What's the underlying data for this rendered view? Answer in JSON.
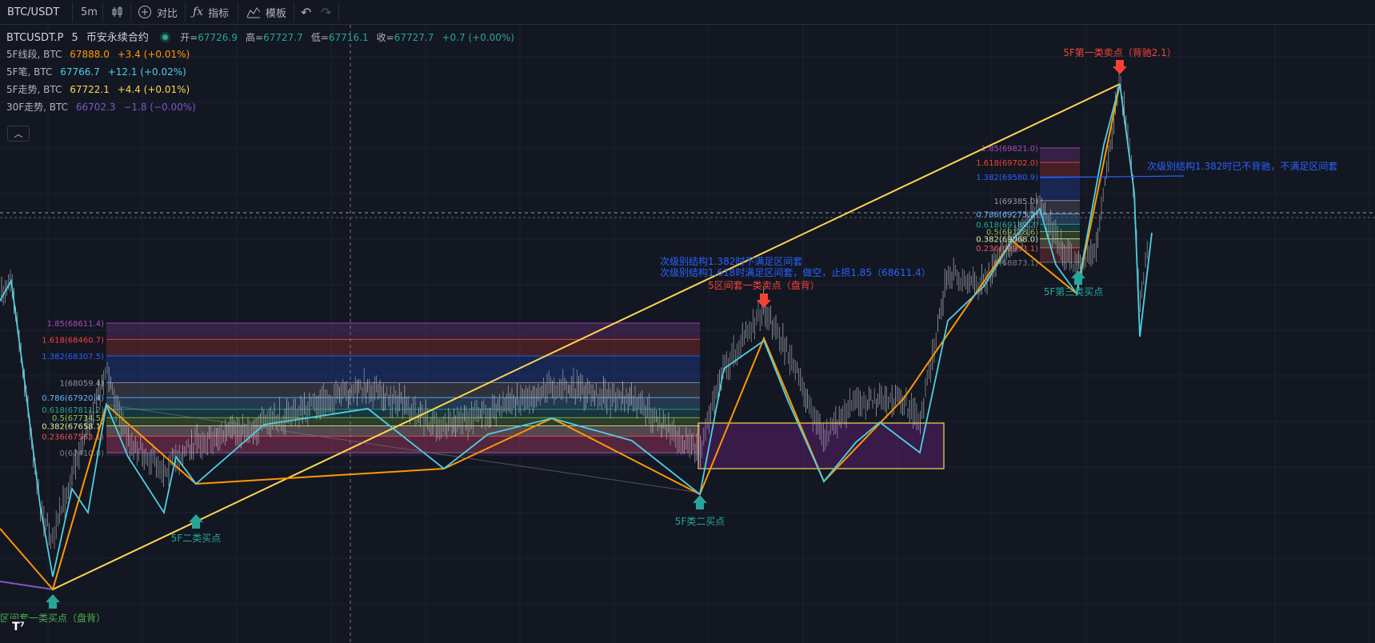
{
  "toolbar": {
    "symbol": "BTC/USDT",
    "interval": "5m",
    "compare_label": "对比",
    "indicators_label": "指标",
    "templates_label": "模板"
  },
  "legend": {
    "symbol": "BTCUSDT.P",
    "interval": "5",
    "exchange": "币安永续合约",
    "open_label": "开=",
    "open": "67726.9",
    "high_label": "高=",
    "high": "67727.7",
    "low_label": "低=",
    "low": "67716.1",
    "close_label": "收=",
    "close": "67727.7",
    "change": "+0.7 (+0.00%)",
    "indicators": [
      {
        "name": "5F线段, BTC",
        "value": "67888.0",
        "change": "+3.4 (+0.01%)",
        "color": "#ff9800"
      },
      {
        "name": "5F笔, BTC",
        "value": "67766.7",
        "change": "+12.1 (+0.02%)",
        "color": "#4dd0e1"
      },
      {
        "name": "5F走势, BTC",
        "value": "67722.1",
        "change": "+4.4 (+0.01%)",
        "color": "#ffd54f"
      },
      {
        "name": "30F走势, BTC",
        "value": "66702.3",
        "change": "−1.8 (−0.00%)",
        "color": "#7e57c2"
      }
    ]
  },
  "chart_data": {
    "type": "candlestick",
    "symbol": "BTCUSDT.P",
    "interval": "5",
    "zones": [
      {
        "name": "zone-1",
        "price_high": 67890,
        "price_low": 67560,
        "color": "#9c27b0"
      },
      {
        "name": "zone-2",
        "price_high": 68180,
        "price_low": 67840,
        "color": "#9c27b0"
      }
    ],
    "fib_left": {
      "levels": [
        {
          "label": "1.85(68611.4)",
          "price": 68611.4,
          "color": "#ab47bc"
        },
        {
          "label": "1.618(68460.7)",
          "price": 68460.7,
          "color": "#f44336"
        },
        {
          "label": "1.382(68307.5)",
          "price": 68307.5,
          "color": "#2962ff"
        },
        {
          "label": "1(68059.4)",
          "price": 68059.4,
          "color": "#9598a1"
        },
        {
          "label": "0.786(67920.4)",
          "price": 67920.4,
          "color": "#64b5f6"
        },
        {
          "label": "0.618(67811.2)",
          "price": 67811.2,
          "color": "#26a69a"
        },
        {
          "label": "0.5(67734.5)",
          "price": 67734.5,
          "color": "#8bc34a"
        },
        {
          "label": "0.382(67658.1)",
          "price": 67658.1,
          "color": "#e6ee9c"
        },
        {
          "label": "0.236(67563.1)",
          "price": 67563.1,
          "color": "#ef5350"
        },
        {
          "label": "0(67410.0)",
          "price": 67410.0,
          "color": "#787b86"
        }
      ]
    },
    "fib_right": {
      "levels": [
        {
          "label": "1.85(69821.0)",
          "price": 69821.0,
          "color": "#ab47bc"
        },
        {
          "label": "1.618(69702.0)",
          "price": 69702.0,
          "color": "#f44336"
        },
        {
          "label": "1.382(69580.9)",
          "price": 69580.9,
          "color": "#2962ff"
        },
        {
          "label": "1(69385.0)",
          "price": 69385.0,
          "color": "#9598a1"
        },
        {
          "label": "0.786(69275.2)",
          "price": 69275.2,
          "color": "#64b5f6"
        },
        {
          "label": "0.618(69189.2)",
          "price": 69189.2,
          "color": "#26a69a"
        },
        {
          "label": "0.5(69128.6)",
          "price": 69128.6,
          "color": "#8bc34a"
        },
        {
          "label": "0.382(69068.0)",
          "price": 69068.0,
          "color": "#e6ee9c"
        },
        {
          "label": "0.236(68993.1)",
          "price": 68993.1,
          "color": "#ef5350"
        },
        {
          "label": "0(68873.1)",
          "price": 68873.1,
          "color": "#787b86"
        }
      ]
    },
    "annotations": [
      {
        "text": "5F第一类卖点（背驰2.1）",
        "color": "#f44336",
        "kind": "sell"
      },
      {
        "text": "次级别结构1.382时已不背驰，不满足区间套",
        "color": "#2962ff",
        "kind": "note"
      },
      {
        "text": "次级别结构1.382时不满足区间套",
        "color": "#2962ff",
        "kind": "note"
      },
      {
        "text": "次级别结构1.618时满足区间套，做空，止损1.85（68611.4）",
        "color": "#2962ff",
        "kind": "note"
      },
      {
        "text": "5区间套一类卖点（盘背）",
        "color": "#f44336",
        "kind": "sell"
      },
      {
        "text": "5F第三类买点",
        "color": "#26a69a",
        "kind": "buy"
      },
      {
        "text": "5F类二买点",
        "color": "#26a69a",
        "kind": "buy"
      },
      {
        "text": "5F二类买点",
        "color": "#26a69a",
        "kind": "buy"
      },
      {
        "text": "区间套一类买点（盘背）",
        "color": "#4caf50",
        "kind": "buy"
      }
    ],
    "series": [
      {
        "name": "5F线段",
        "color": "#ff9800"
      },
      {
        "name": "5F笔",
        "color": "#4dd0e1"
      },
      {
        "name": "5F走势",
        "color": "#ffd54f"
      },
      {
        "name": "30F走势",
        "color": "#7e57c2"
      }
    ]
  }
}
